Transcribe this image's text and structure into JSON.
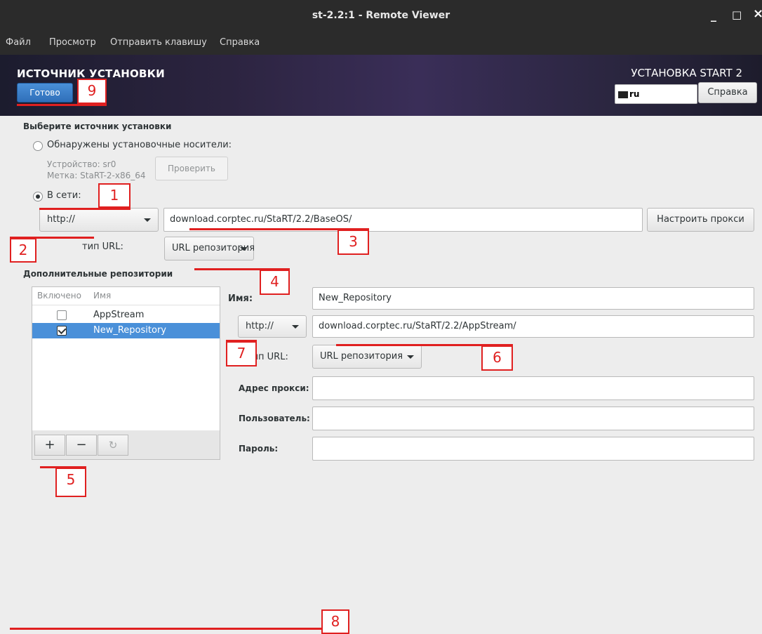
{
  "window": {
    "title": "st-2.2:1 - Remote Viewer",
    "minimize": "_",
    "maximize": "□",
    "close": "×"
  },
  "menu": [
    "Файл",
    "Просмотр",
    "Отправить клавишу",
    "Справка"
  ],
  "header": {
    "spoke_title": "ИСТОЧНИК УСТАНОВКИ",
    "done_label": "Готово",
    "product": "УСТАНОВКА START 2",
    "keyboard_layout": "ru",
    "help_label": "Справка"
  },
  "source": {
    "section_title": "Выберите источник установки",
    "media_radio_label": "Обнаружены установочные носители:",
    "device_line": "Устройство: sr0",
    "label_line": "Метка: StaRT-2-x86_64",
    "verify_label": "Проверить",
    "network_radio_label": "В сети:",
    "protocol": "http://",
    "url": "download.corptec.ru/StaRT/2.2/BaseOS/",
    "proxy_button": "Настроить прокси",
    "url_type_label": "тип URL:",
    "url_type_value": "URL репозитория"
  },
  "repos": {
    "section_title": "Дополнительные репозитории",
    "col_enabled": "Включено",
    "col_name": "Имя",
    "items": [
      {
        "name": "AppStream",
        "enabled": false,
        "selected": false
      },
      {
        "name": "New_Repository",
        "enabled": true,
        "selected": true
      }
    ],
    "add_label": "+",
    "remove_label": "−",
    "revert_label": "↻"
  },
  "repo_detail": {
    "name_label": "Имя:",
    "name_value": "New_Repository",
    "protocol": "http://",
    "url": "download.corptec.ru/StaRT/2.2/AppStream/",
    "url_type_label": "тип URL:",
    "url_type_value": "URL репозитория",
    "proxy_label": "Адрес прокси:",
    "proxy_value": "",
    "user_label": "Пользователь:",
    "user_value": "",
    "password_label": "Пароль:",
    "password_value": ""
  },
  "annotations": [
    "1",
    "2",
    "3",
    "4",
    "5",
    "6",
    "7",
    "8",
    "9"
  ],
  "colors": {
    "accent": "#4a90d9",
    "annotation": "#e02020",
    "titlebar": "#2b2b2b"
  }
}
